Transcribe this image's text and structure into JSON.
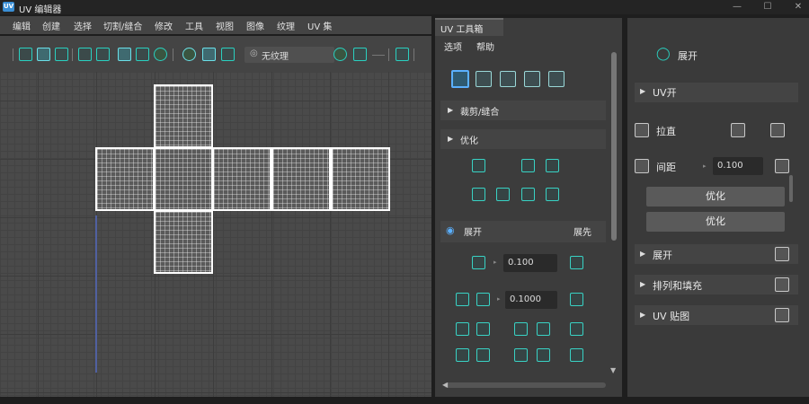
{
  "window": {
    "logo_text": "UV",
    "title": "UV 编辑器",
    "minimize": "—",
    "maximize": "☐",
    "close": "✕"
  },
  "menubar": {
    "items": [
      "编辑",
      "创建",
      "选择",
      "切割/缝合",
      "修改",
      "工具",
      "视图",
      "图像",
      "纹理",
      "UV 集"
    ]
  },
  "toolbar": {
    "texture_icon": "◎",
    "texture_value": "无纹理",
    "accent_color": "#2ad0c0"
  },
  "uv_toolkit": {
    "tab_label": "UV 工具箱",
    "menu": {
      "options": "选项",
      "help": "帮助"
    },
    "cut_sew": {
      "label": "裁剪/缝合"
    },
    "optimize": {
      "label": "优化"
    },
    "unfold": {
      "label": "展开",
      "right_label": "展先",
      "value_1": "0.100",
      "value_2": "0.1000"
    }
  },
  "right_panel": {
    "top_label": "展开",
    "unfold_label": "UV开",
    "straighten_label": "拉直",
    "spacing_label": "间距",
    "spacing_value": "0.100",
    "optimize_btn_1": "优化",
    "optimize_btn_2": "优化",
    "sections": [
      "展开",
      "排列和填充",
      "UV 贴图"
    ]
  }
}
